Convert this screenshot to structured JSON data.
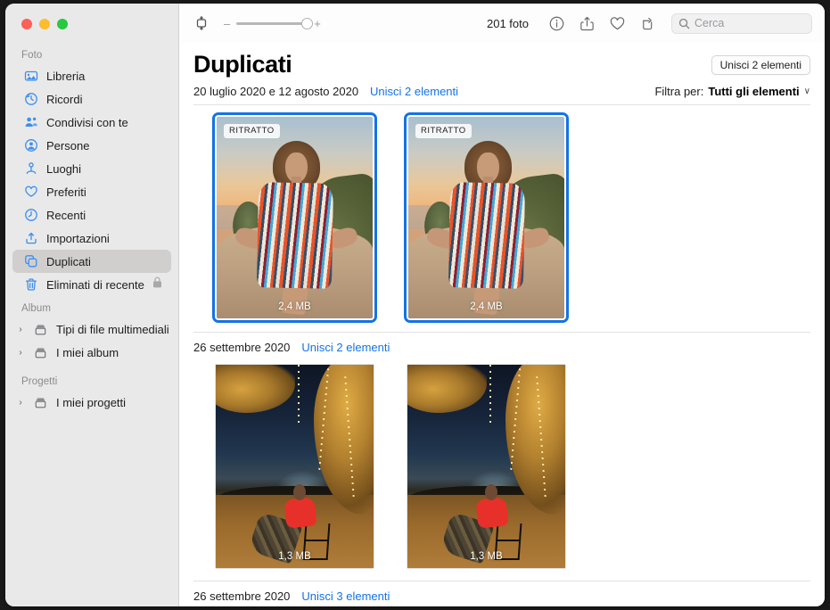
{
  "window": {
    "traffic_lights": [
      "close",
      "minimize",
      "zoom"
    ]
  },
  "toolbar": {
    "sidebar_toggle_icon": "sidebar-toggle-icon",
    "zoom_out_label": "–",
    "zoom_in_label": "+",
    "photo_count": "201 foto",
    "info_icon": "info-icon",
    "share_icon": "share-icon",
    "favorite_icon": "heart-icon",
    "rotate_icon": "rotate-icon",
    "search": {
      "placeholder": "Cerca",
      "value": "",
      "icon": "search-icon"
    }
  },
  "sidebar": {
    "sections": [
      {
        "title": "Foto",
        "items": [
          {
            "label": "Libreria",
            "icon": "photos-library-icon",
            "selected": false
          },
          {
            "label": "Ricordi",
            "icon": "memories-icon",
            "selected": false
          },
          {
            "label": "Condivisi con te",
            "icon": "shared-with-you-icon",
            "selected": false
          },
          {
            "label": "Persone",
            "icon": "people-icon",
            "selected": false
          },
          {
            "label": "Luoghi",
            "icon": "places-pin-icon",
            "selected": false
          },
          {
            "label": "Preferiti",
            "icon": "heart-icon",
            "selected": false
          },
          {
            "label": "Recenti",
            "icon": "clock-icon",
            "selected": false
          },
          {
            "label": "Importazioni",
            "icon": "import-icon",
            "selected": false
          },
          {
            "label": "Duplicati",
            "icon": "duplicates-icon",
            "selected": true
          },
          {
            "label": "Eliminati di recente",
            "icon": "trash-icon",
            "selected": false,
            "lock": "lock-icon"
          }
        ]
      },
      {
        "title": "Album",
        "items": [
          {
            "label": "Tipi di file multimediali",
            "icon": "album-icon",
            "disclosure": "›"
          },
          {
            "label": "I miei album",
            "icon": "album-icon",
            "disclosure": "›"
          }
        ]
      },
      {
        "title": "Progetti",
        "items": [
          {
            "label": "I miei progetti",
            "icon": "album-icon",
            "disclosure": "›"
          }
        ]
      }
    ]
  },
  "main": {
    "page_title": "Duplicati",
    "merge_all_button": "Unisci 2 elementi",
    "filter": {
      "label": "Filtra per:",
      "value": "Tutti gli elementi",
      "chevron": "∨"
    },
    "groups": [
      {
        "date": "20 luglio 2020 e 12 agosto 2020",
        "merge_link": "Unisci 2 elementi",
        "photos": [
          {
            "badge": "RITRATTO",
            "size": "2,4 MB",
            "selected": true,
            "art": "woman-sunset"
          },
          {
            "badge": "RITRATTO",
            "size": "2,4 MB",
            "selected": true,
            "art": "woman-sunset"
          }
        ]
      },
      {
        "date": "26 settembre 2020",
        "merge_link": "Unisci 2 elementi",
        "photos": [
          {
            "badge": "",
            "size": "1,3 MB",
            "selected": false,
            "art": "man-lights"
          },
          {
            "badge": "",
            "size": "1,3 MB",
            "selected": false,
            "art": "man-lights"
          }
        ]
      },
      {
        "date": "26 settembre 2020",
        "merge_link": "Unisci 3 elementi",
        "photos": []
      }
    ]
  },
  "colors": {
    "accent_blue": "#1473e6",
    "sidebar_bg": "#e9e9e9",
    "selection_bg": "#d0cfce",
    "icon_blue": "#3b8ef0"
  }
}
